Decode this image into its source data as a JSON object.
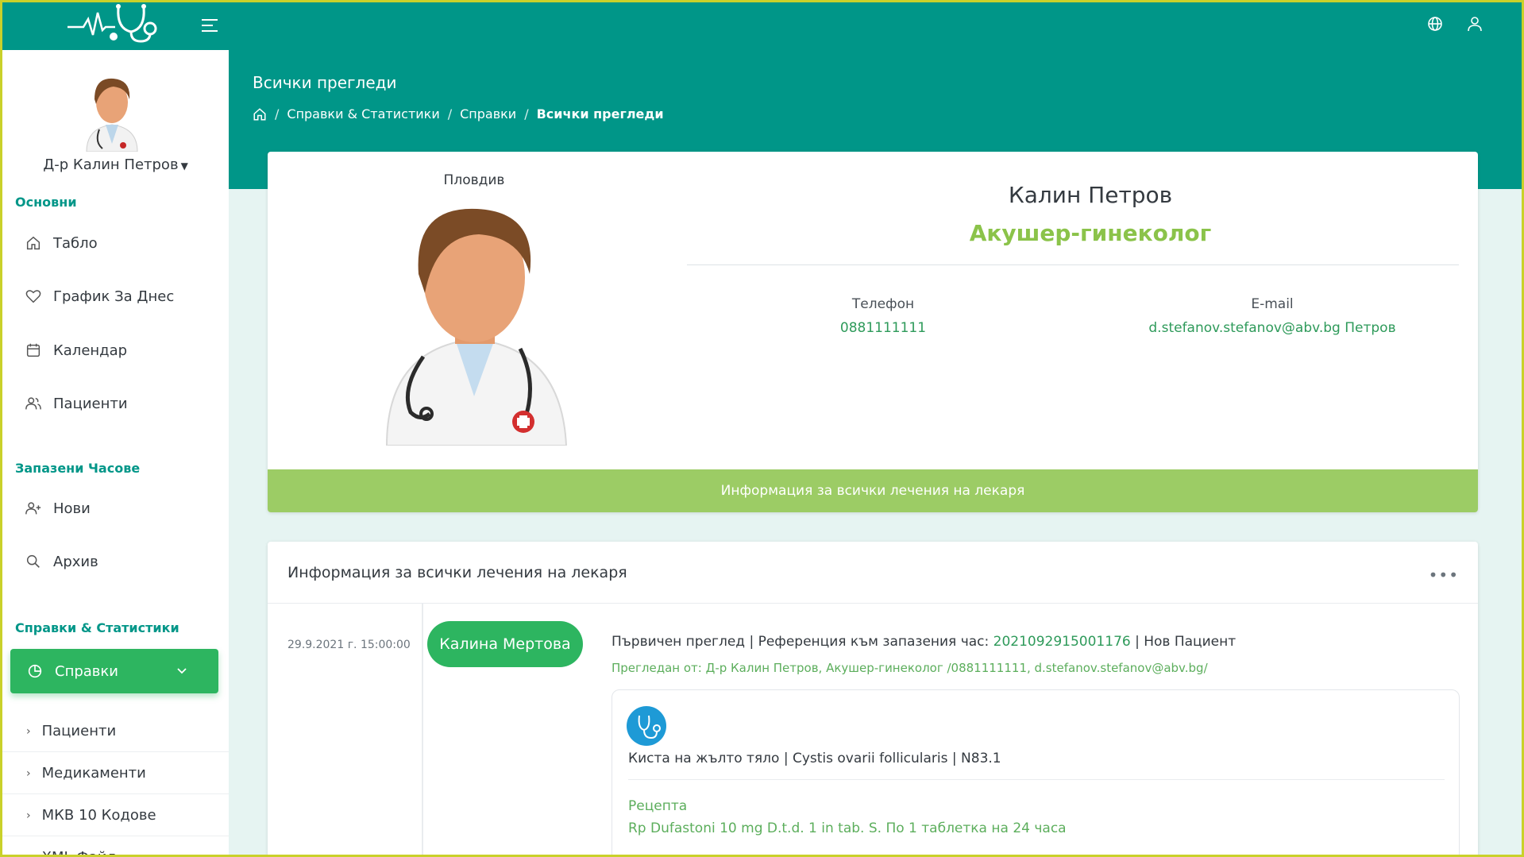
{
  "colors": {
    "primary": "#009688",
    "accent_green": "#2db560",
    "light_green": "#9ccc65",
    "specialty_green": "#8bc34a",
    "background": "#e6f4f2"
  },
  "topbar": {
    "logo_icon": "heartbeat-stethoscope-logo",
    "menu_icon": "menu-toggle-icon",
    "language_icon": "globe-icon",
    "user_icon": "user-icon"
  },
  "sidebar": {
    "user_name": "Д-р Калин Петров",
    "section_main": "Основни",
    "main_items": [
      {
        "label": "Табло",
        "icon": "home-icon"
      },
      {
        "label": "График За Днес",
        "icon": "heart-icon"
      },
      {
        "label": "Календар",
        "icon": "calendar-icon"
      },
      {
        "label": "Пациенти",
        "icon": "users-icon"
      }
    ],
    "section_appointments": "Запазени Часове",
    "appointment_items": [
      {
        "label": "Нови",
        "icon": "user-plus-icon"
      },
      {
        "label": "Архив",
        "icon": "search-icon"
      }
    ],
    "section_reports": "Справки & Статистики",
    "active_item": {
      "label": "Справки",
      "icon": "pie-chart-icon"
    },
    "sub_items": [
      {
        "label": "Пациенти"
      },
      {
        "label": "Медикаменти"
      },
      {
        "label": "МКВ 10 Кодове"
      },
      {
        "label": "XML Файл"
      }
    ]
  },
  "header": {
    "title": "Всички прегледи",
    "breadcrumb": [
      "Справки & Статистики",
      "Справки",
      "Всички прегледи"
    ]
  },
  "profile_card": {
    "city": "Пловдив",
    "name": "Калин Петров",
    "specialty": "Акушер-гинеколог",
    "phone_label": "Телефон",
    "phone": "0881111111",
    "email_label": "E-mail",
    "email": "d.stefanov.stefanov@abv.bg Петров",
    "bar_label": "Информация за всички лечения на лекаря"
  },
  "treatments": {
    "title": "Информация за всички лечения на лекаря",
    "more": "•••",
    "entries": [
      {
        "date": "29.9.2021 г. 15:00:00",
        "patient": "Калина Мертова",
        "title_prefix": "Първичен преглед | Референция към запазения час: ",
        "reference": "2021092915001176",
        "title_suffix": " | Нов Пациент",
        "examined_by": "Прегледан от: Д-р Калин Петров, Акушер-гинеколог /0881111111, d.stefanov.stefanov@abv.bg/",
        "diagnosis": "Киста на жълто тяло | Cystis ovarii follicularis | N83.1",
        "prescription_label": "Рецепта",
        "prescription": "Rp Dufastoni 10 mg D.t.d. 1 in tab. S. По 1 таблетка на 24 часа"
      }
    ]
  }
}
